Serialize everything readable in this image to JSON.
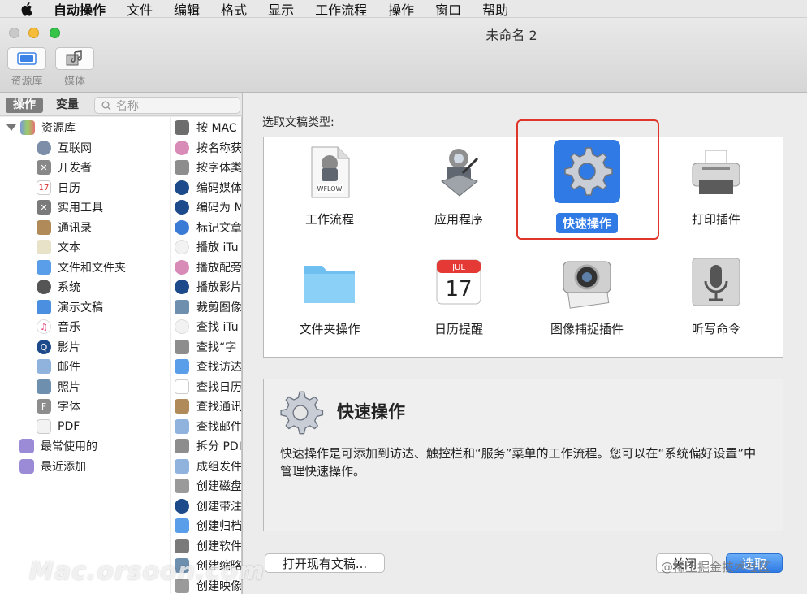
{
  "menubar": {
    "items": [
      "自动操作",
      "文件",
      "编辑",
      "格式",
      "显示",
      "工作流程",
      "操作",
      "窗口",
      "帮助"
    ]
  },
  "window": {
    "title": "未命名 2",
    "toolbar": {
      "library_label": "资源库",
      "media_label": "媒体"
    }
  },
  "left_pane": {
    "tabs": {
      "actions": "操作",
      "variables": "变量"
    },
    "search_placeholder": "名称",
    "library_root": "资源库",
    "library_items": [
      "互联网",
      "开发者",
      "日历",
      "实用工具",
      "通讯录",
      "文本",
      "文件和文件夹",
      "系统",
      "演示文稿",
      "音乐",
      "影片",
      "邮件",
      "照片",
      "字体",
      "PDF"
    ],
    "smart_groups": [
      "最常使用的",
      "最近添加"
    ],
    "action_items": [
      "按 MAC",
      "按名称获",
      "按字体类",
      "编码媒体",
      "编码为 M",
      "标记文章",
      "播放 iTu",
      "播放配旁",
      "播放影片",
      "裁剪图像",
      "查找 iTu",
      "查找“字",
      "查找访达",
      "查找日历",
      "查找通讯",
      "查找邮件",
      "拆分 PDI",
      "成组发件",
      "创建磁盘",
      "创建带注",
      "创建归档",
      "创建软件",
      "创建缩略",
      "创建映像"
    ]
  },
  "sheet": {
    "heading": "选取文稿类型:",
    "doc_types": [
      {
        "label": "工作流程",
        "icon": "workflow-icon",
        "badge": "WFLOW"
      },
      {
        "label": "应用程序",
        "icon": "application-icon"
      },
      {
        "label": "快速操作",
        "icon": "quick-action-gear-icon",
        "selected": true
      },
      {
        "label": "打印插件",
        "icon": "printer-icon"
      },
      {
        "label": "文件夹操作",
        "icon": "folder-icon"
      },
      {
        "label": "日历提醒",
        "icon": "calendar-icon",
        "month": "JUL",
        "day": "17"
      },
      {
        "label": "图像捕捉插件",
        "icon": "camera-icon"
      },
      {
        "label": "听写命令",
        "icon": "microphone-icon"
      }
    ],
    "description": {
      "title": "快速操作",
      "text": "快速操作是可添加到访达、触控栏和“服务”菜单的工作流程。您可以在“系统偏好设置”中管理快速操作。"
    },
    "buttons": {
      "open_existing": "打开现有文稿...",
      "close": "关闭",
      "choose": "选取"
    }
  },
  "watermarks": {
    "left": "Mac.orsoon.com",
    "right": "@稀土掘金技术社区"
  },
  "colors": {
    "accent": "#2f7ae5",
    "highlight_frame": "#e0352b"
  }
}
